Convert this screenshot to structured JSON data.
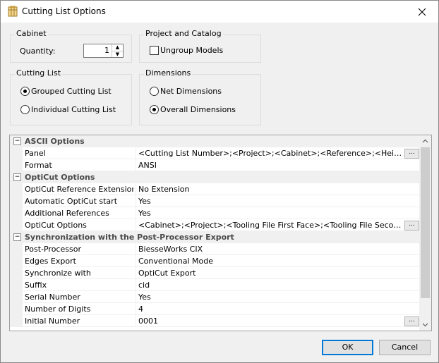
{
  "window": {
    "title": "Cutting List Options",
    "icon": "cutting-list-icon",
    "close": "✕"
  },
  "cabinet": {
    "title": "Cabinet",
    "quantity_label": "Quantity:",
    "quantity_value": "1"
  },
  "project": {
    "title": "Project and Catalog",
    "ungroup_label": "Ungroup Models",
    "ungroup_checked": false
  },
  "cutting_list": {
    "title": "Cutting List",
    "options": [
      "Grouped Cutting List",
      "Individual Cutting List"
    ],
    "selected": "Grouped Cutting List"
  },
  "dimensions": {
    "title": "Dimensions",
    "options": [
      "Net Dimensions",
      "Overall Dimensions"
    ],
    "selected": "Overall Dimensions"
  },
  "grid": {
    "categories": [
      {
        "label": "ASCII Options",
        "toggle": "⊟"
      },
      {
        "label": "OptiCut Options",
        "toggle": "⊟"
      },
      {
        "label": "Synchronization with the Post-Processor Export",
        "toggle": "⊟"
      }
    ],
    "properties": [
      {
        "name": "Panel",
        "value": "<Cutting List Number>;<Project>;<Cabinet>;<Reference>;<Height>;<Width>;<Thickness>",
        "ellipsis": "..."
      },
      {
        "name": "Format",
        "value": "ANSI"
      },
      {
        "name": "OptiCut Reference Extension",
        "value": "No Extension"
      },
      {
        "name": "Automatic OptiCut start",
        "value": "Yes"
      },
      {
        "name": "Additional References",
        "value": "Yes"
      },
      {
        "name": "OptiCut Options",
        "value": "<Cabinet>;<Project>;<Tooling File First Face>;<Tooling File Second Face>",
        "ellipsis": "..."
      },
      {
        "name": "Post-Processor",
        "value": "BiesseWorks CIX"
      },
      {
        "name": "Edges Export",
        "value": "Conventional Mode"
      },
      {
        "name": "Synchronize with",
        "value": "OptiCut Export"
      },
      {
        "name": "Suffix",
        "value": "cid"
      },
      {
        "name": "Serial Number",
        "value": "Yes"
      },
      {
        "name": "Number of Digits",
        "value": "4"
      },
      {
        "name": "Initial Number",
        "value": "0001",
        "ellipsis": "..."
      }
    ]
  },
  "buttons": {
    "ok": "OK",
    "cancel": "Cancel"
  },
  "colors": {
    "accent": "#0078d7",
    "category_bg": "#f0f0f0",
    "category_text": "#4a4a4a"
  }
}
